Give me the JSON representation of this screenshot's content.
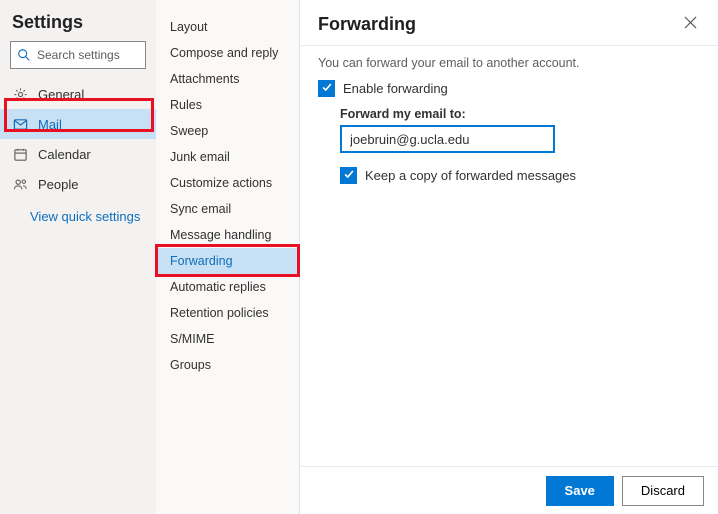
{
  "header": {
    "title": "Settings",
    "search_placeholder": "Search settings"
  },
  "nav": {
    "items": [
      {
        "label": "General"
      },
      {
        "label": "Mail"
      },
      {
        "label": "Calendar"
      },
      {
        "label": "People"
      }
    ],
    "quick_link": "View quick settings"
  },
  "sub": {
    "items": [
      {
        "label": "Layout"
      },
      {
        "label": "Compose and reply"
      },
      {
        "label": "Attachments"
      },
      {
        "label": "Rules"
      },
      {
        "label": "Sweep"
      },
      {
        "label": "Junk email"
      },
      {
        "label": "Customize actions"
      },
      {
        "label": "Sync email"
      },
      {
        "label": "Message handling"
      },
      {
        "label": "Forwarding"
      },
      {
        "label": "Automatic replies"
      },
      {
        "label": "Retention policies"
      },
      {
        "label": "S/MIME"
      },
      {
        "label": "Groups"
      }
    ]
  },
  "panel": {
    "title": "Forwarding",
    "intro": "You can forward your email to another account.",
    "enable_label": "Enable forwarding",
    "forward_to_label": "Forward my email to:",
    "forward_to_value": "joebruin@g.ucla.edu",
    "keep_copy_label": "Keep a copy of forwarded messages",
    "save": "Save",
    "discard": "Discard"
  }
}
